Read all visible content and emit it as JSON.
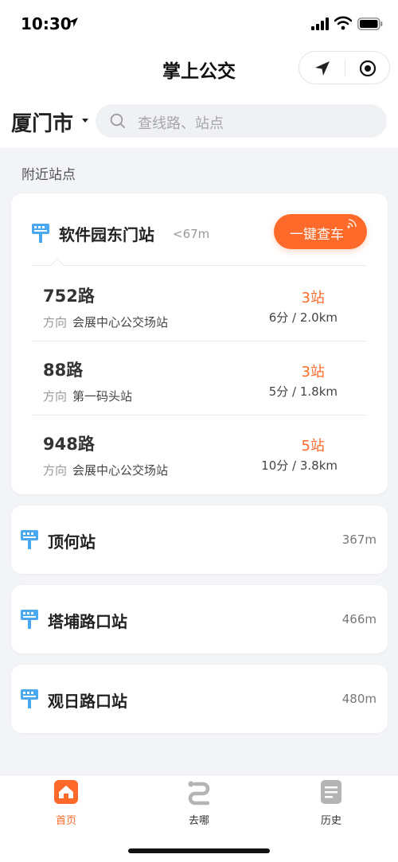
{
  "status_bar": {
    "time": "10:30"
  },
  "header": {
    "title": "掌上公交"
  },
  "toolbar": {
    "city": "厦门市",
    "search_placeholder": "查线路、站点"
  },
  "nearby": {
    "section_title": "附近站点",
    "main_stop": {
      "name": "软件园东门站",
      "distance": "<67m",
      "button_label": "一键查车",
      "routes": [
        {
          "number": "752路",
          "direction_label": "方向",
          "direction": "会展中心公交场站",
          "stops": "3站",
          "eta": "6分 / 2.0km"
        },
        {
          "number": "88路",
          "direction_label": "方向",
          "direction": "第一码头站",
          "stops": "3站",
          "eta": "5分 / 1.8km"
        },
        {
          "number": "948路",
          "direction_label": "方向",
          "direction": "会展中心公交场站",
          "stops": "5站",
          "eta": "10分 / 3.8km"
        }
      ]
    },
    "other_stops": [
      {
        "name": "顶何站",
        "distance": "367m"
      },
      {
        "name": "塔埔路口站",
        "distance": "466m"
      },
      {
        "name": "观日路口站",
        "distance": "480m"
      }
    ]
  },
  "tabbar": {
    "items": [
      {
        "label": "首页",
        "icon": "home-icon",
        "active": true
      },
      {
        "label": "去哪",
        "icon": "route-icon",
        "active": false
      },
      {
        "label": "历史",
        "icon": "history-icon",
        "active": false
      }
    ]
  },
  "colors": {
    "accent": "#ff6a2a",
    "bus_icon": "#4aa8f0",
    "background": "#f3f4f7"
  }
}
